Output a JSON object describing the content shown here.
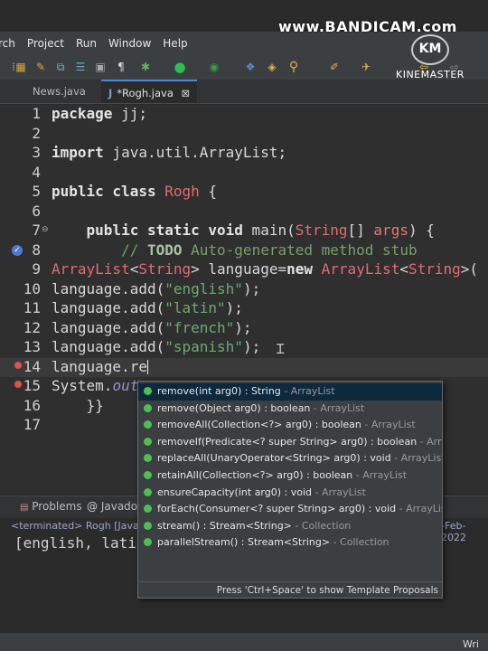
{
  "watermark": {
    "brand": "www.BANDICAM.com",
    "logo_text": "KM",
    "app": "KINEMASTER"
  },
  "menu": [
    "rch",
    "Project",
    "Run",
    "Window",
    "Help"
  ],
  "tabs": [
    {
      "label": "News.java"
    },
    {
      "label": "*Rogh.java",
      "close": "⊠"
    }
  ],
  "editor": {
    "line_numbers": [
      "1",
      "2",
      "3",
      "4",
      "5",
      "6",
      "7",
      "8",
      "9",
      "10",
      "11",
      "12",
      "13",
      "14",
      "15",
      "16",
      "17"
    ],
    "lines": {
      "l1": [
        "package",
        " jj;"
      ],
      "l3": [
        "import",
        " java.util.ArrayList;"
      ],
      "l5": [
        "public class",
        " ",
        "Rogh",
        " {"
      ],
      "l7": [
        "    ",
        "public static void",
        " main(",
        "String",
        "[] ",
        "args",
        ") {"
      ],
      "l8": [
        "        // ",
        "TODO",
        " Auto-generated method stub"
      ],
      "l9": [
        "ArrayList",
        "<",
        "String",
        "> language=",
        "new",
        " ",
        "ArrayList",
        "<",
        "String",
        ">("
      ],
      "l10": [
        "language.add(",
        "\"english\"",
        ");"
      ],
      "l11": [
        "language.add(",
        "\"latin\"",
        ");"
      ],
      "l12": [
        "language.add(",
        "\"french\"",
        ");"
      ],
      "l13": [
        "language.add(",
        "\"spanish\"",
        ");"
      ],
      "l14": [
        "language.re"
      ],
      "l15": [
        "System.",
        "out"
      ],
      "l16": [
        "    }}"
      ]
    }
  },
  "autocomplete": {
    "items": [
      {
        "sig": "remove(int arg0) : String",
        "type": " - ArrayList"
      },
      {
        "sig": "remove(Object arg0) : boolean",
        "type": " - ArrayList"
      },
      {
        "sig": "removeAll(Collection<?> arg0) : boolean",
        "type": " - ArrayList"
      },
      {
        "sig": "removeIf(Predicate<? super String> arg0) : boolean",
        "type": " - ArrayList"
      },
      {
        "sig": "replaceAll(UnaryOperator<String> arg0) : void",
        "type": " - ArrayList"
      },
      {
        "sig": "retainAll(Collection<?> arg0) : boolean",
        "type": " - ArrayList"
      },
      {
        "sig": "ensureCapacity(int arg0) : void",
        "type": " - ArrayList"
      },
      {
        "sig": "forEach(Consumer<? super String> arg0) : void",
        "type": " - ArrayList"
      },
      {
        "sig": "stream() : Stream<String>",
        "type": " - Collection"
      },
      {
        "sig": "parallelStream() : Stream<String>",
        "type": " - Collection"
      }
    ],
    "footer": "Press 'Ctrl+Space' to show Template Proposals"
  },
  "bottom_panel": {
    "tabs": [
      "Problems",
      "Javado"
    ],
    "terminated": "<terminated> Rogh [Java A",
    "terminated_date": "-Feb-2022",
    "output": "[english, lati"
  },
  "status": {
    "right": "Wri"
  },
  "colors": {
    "keyword": "#e4e4e4",
    "class": "#e06c75",
    "string": "#6aab73",
    "comment": "#7a9e6a",
    "popup_bg": "#3c3f41",
    "method_icon": "#4fbf4f"
  }
}
